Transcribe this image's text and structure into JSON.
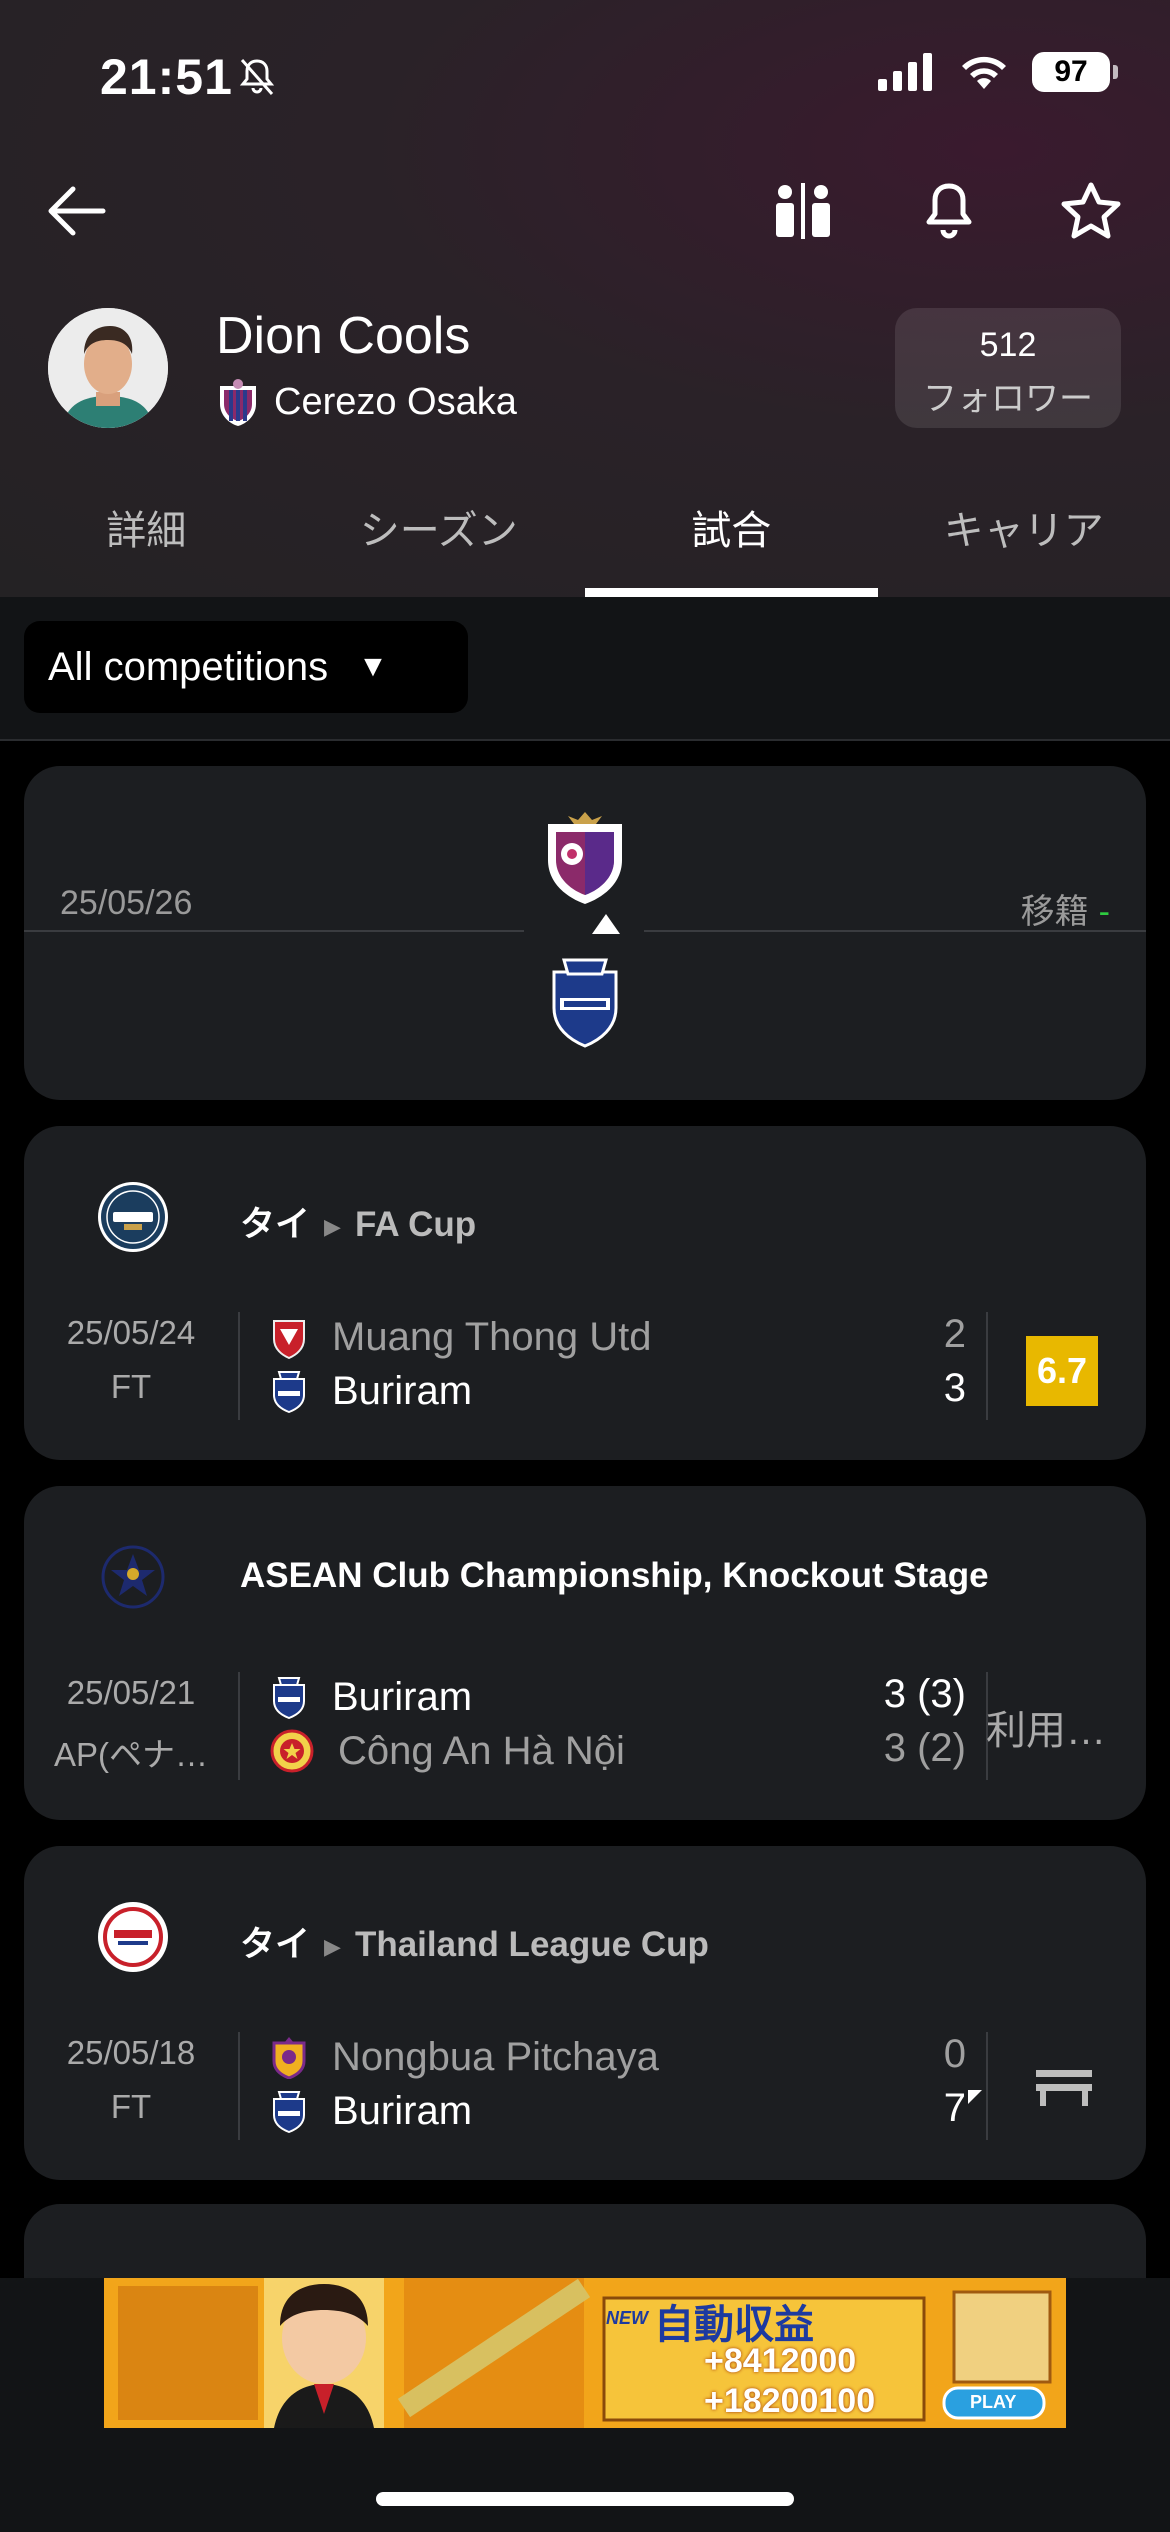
{
  "status": {
    "time": "21:51",
    "battery": "97"
  },
  "player": {
    "name": "Dion Cools",
    "team": "Cerezo Osaka",
    "followers_count": "512",
    "followers_label": "フォロワー"
  },
  "tabs": [
    "詳細",
    "シーズン",
    "試合",
    "キャリア"
  ],
  "filter": {
    "label": "All competitions"
  },
  "transfer": {
    "date": "25/05/26",
    "label": "移籍",
    "dash": "-"
  },
  "matches": [
    {
      "country": "タイ",
      "league": "FA Cup",
      "date": "25/05/24",
      "status": "FT",
      "home": "Muang Thong Utd",
      "away": "Buriram",
      "home_score": "2",
      "away_score": "3",
      "rating": "6.7",
      "rating_color": "#e8b800"
    },
    {
      "country": "",
      "league": "ASEAN Club Championship, Knockout Stage",
      "date": "25/05/21",
      "status": "AP(ペナ…",
      "home": "Buriram",
      "away": "Công An Hà Nội",
      "home_score": "3 (3)",
      "away_score": "3 (2)",
      "rating": "利用…"
    },
    {
      "country": "タイ",
      "league": "Thailand League Cup",
      "date": "25/05/18",
      "status": "FT",
      "home": "Nongbua Pitchaya",
      "away": "Buriram",
      "home_score": "0",
      "away_score": "7",
      "rating_icon": "bench-icon"
    }
  ],
  "ad": {
    "headline": "自動収益",
    "value1": "+8412000",
    "value2": "+18200100",
    "badge": "NEW",
    "play": "PLAY"
  },
  "icons": [
    "back-arrow-icon",
    "compare-icon",
    "bell-icon",
    "star-icon",
    "mute-bell-icon",
    "signal-icon",
    "wifi-icon"
  ]
}
